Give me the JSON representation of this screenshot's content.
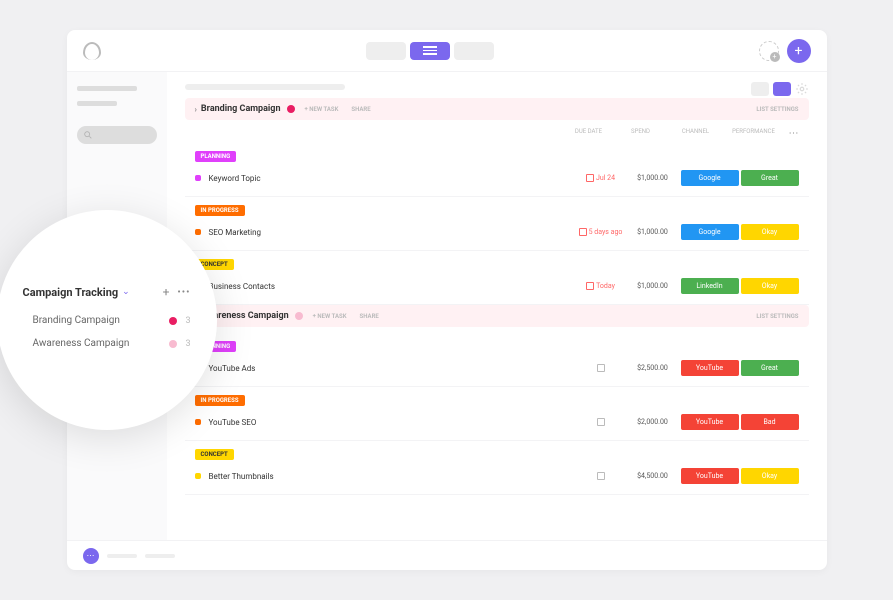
{
  "header": {
    "add_label": "+"
  },
  "popover": {
    "title": "Campaign Tracking",
    "items": [
      {
        "label": "Branding Campaign",
        "count": "3",
        "dot": "dot-r"
      },
      {
        "label": "Awareness Campaign",
        "count": "3",
        "dot": "dot-p"
      }
    ]
  },
  "columns": {
    "due": "DUE DATE",
    "spend": "SPEND",
    "channel": "CHANNEL",
    "performance": "PERFORMANCE"
  },
  "folders": [
    {
      "name": "Branding Campaign",
      "variant": "pink",
      "new_task": "+ NEW TASK",
      "share": "SHARE",
      "right": "LIST SETTINGS",
      "groups": [
        {
          "status": "PLANNING",
          "cls": "pl",
          "bullet": "b-pl",
          "tasks": [
            {
              "name": "Keyword Topic",
              "due": "Jul 24",
              "due_cls": "",
              "spend": "$1,000.00",
              "channel": "Google",
              "channel_cls": "g-blue",
              "perf": "Great",
              "perf_cls": "g-green"
            }
          ]
        },
        {
          "status": "IN PROGRESS",
          "cls": "pr",
          "bullet": "b-pr",
          "tasks": [
            {
              "name": "SEO Marketing",
              "due": "5 days ago",
              "due_cls": "",
              "spend": "$1,000.00",
              "channel": "Google",
              "channel_cls": "g-blue",
              "perf": "Okay",
              "perf_cls": "g-yellow"
            }
          ]
        },
        {
          "status": "CONCEPT",
          "cls": "co",
          "bullet": "b-co",
          "tasks": [
            {
              "name": "Business Contacts",
              "due": "Today",
              "due_cls": "",
              "spend": "$1,000.00",
              "channel": "LinkedIn",
              "channel_cls": "g-green",
              "perf": "Okay",
              "perf_cls": "g-yellow"
            }
          ]
        }
      ]
    },
    {
      "name": "Awareness Campaign",
      "variant": "lp",
      "new_task": "+ NEW TASK",
      "share": "SHARE",
      "right": "LIST SETTINGS",
      "groups": [
        {
          "status": "PLANNING",
          "cls": "pl",
          "bullet": "b-pl",
          "tasks": [
            {
              "name": "YouTube Ads",
              "due": "",
              "due_cls": "gray",
              "spend": "$2,500.00",
              "channel": "YouTube",
              "channel_cls": "g-red",
              "perf": "Great",
              "perf_cls": "g-green"
            }
          ]
        },
        {
          "status": "IN PROGRESS",
          "cls": "pr",
          "bullet": "b-pr",
          "tasks": [
            {
              "name": "YouTube SEO",
              "due": "",
              "due_cls": "gray",
              "spend": "$2,000.00",
              "channel": "YouTube",
              "channel_cls": "g-red",
              "perf": "Bad",
              "perf_cls": "g-red"
            }
          ]
        },
        {
          "status": "CONCEPT",
          "cls": "co",
          "bullet": "b-co",
          "tasks": [
            {
              "name": "Better Thumbnails",
              "due": "",
              "due_cls": "gray",
              "spend": "$4,500.00",
              "channel": "YouTube",
              "channel_cls": "g-red",
              "perf": "Okay",
              "perf_cls": "g-yellow"
            }
          ]
        }
      ]
    }
  ]
}
